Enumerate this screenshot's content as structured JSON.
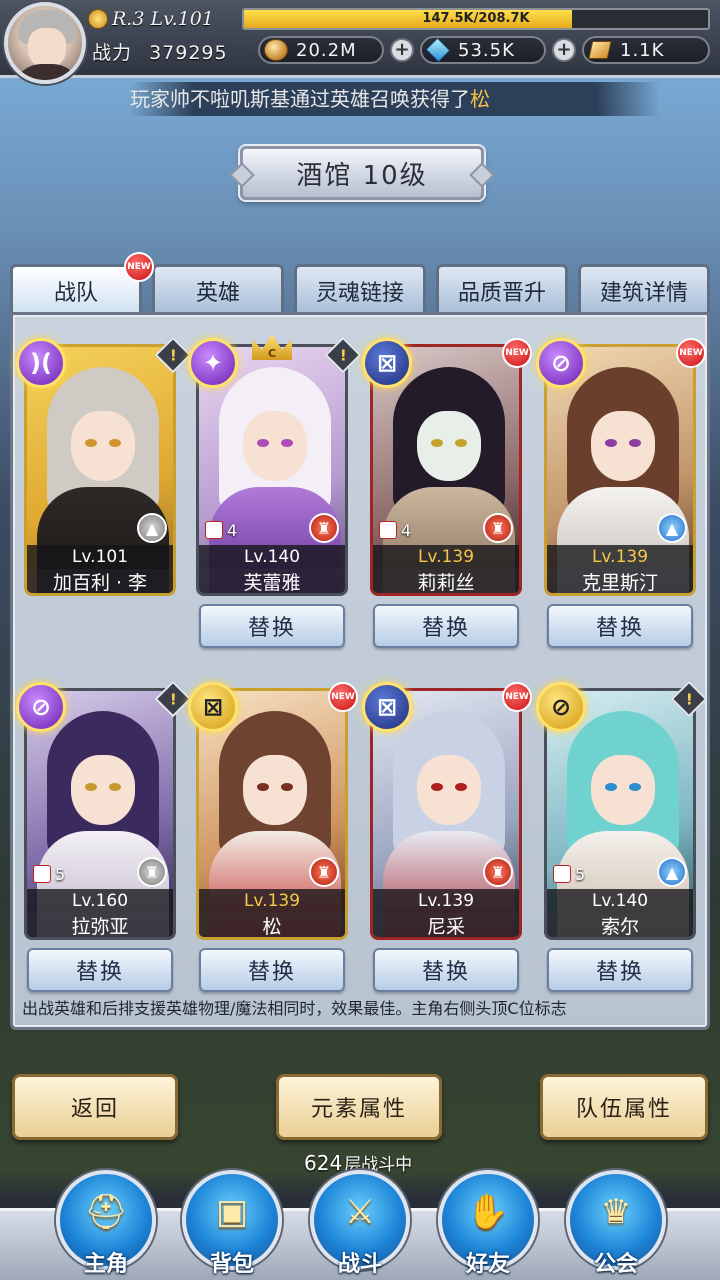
{
  "player": {
    "rank_level": "R.3 Lv.101",
    "exp_text": "147.5K/208.7K",
    "exp_progress": 0.707,
    "power_label": "战力",
    "power_value": "379295"
  },
  "currencies": [
    {
      "name": "gold",
      "value": "20.2M",
      "icon": "coin-icon"
    },
    {
      "name": "diamond",
      "value": "53.5K",
      "icon": "gem-icon"
    },
    {
      "name": "card",
      "value": "1.1K",
      "icon": "card-icon"
    }
  ],
  "marquee": {
    "prefix": "玩家帅不啦叽斯基通过英雄召唤获得了",
    "highlight": "松"
  },
  "title": "酒馆 10级",
  "tabs": [
    {
      "label": "战队",
      "active": true,
      "new": true
    },
    {
      "label": "英雄"
    },
    {
      "label": "灵魂链接"
    },
    {
      "label": "品质晋升"
    },
    {
      "label": "建筑详情"
    }
  ],
  "new_badge_text": "NEW",
  "alert_text": "!",
  "crown_text": "C",
  "heroes": [
    {
      "name": "加百利 · 李",
      "level": "Lv.101",
      "element": "purple",
      "element_glyph": ")(",
      "type_icon": "grey",
      "frame": "gold",
      "skills": "",
      "alert": true
    },
    {
      "name": "芙蕾雅",
      "level": "Lv.140",
      "element": "purple",
      "element_glyph": "✦",
      "type_icon": "red",
      "frame": "grey",
      "skills": "4",
      "alert": true,
      "crown": true
    },
    {
      "name": "莉莉丝",
      "level": "Lv.139",
      "element": "navy",
      "element_glyph": "⊠",
      "type_icon": "red",
      "frame": "red",
      "skills": "4",
      "new": true
    },
    {
      "name": "克里斯汀",
      "level": "Lv.139",
      "element": "purple",
      "element_glyph": "⊘",
      "type_icon": "blue",
      "frame": "gold",
      "skills": "",
      "new": true
    },
    {
      "name": "拉弥亚",
      "level": "Lv.160",
      "element": "purple",
      "element_glyph": "⊘",
      "type_icon": "grey",
      "frame": "grey",
      "skills": "5",
      "alert": true
    },
    {
      "name": "松",
      "level": "Lv.139",
      "element": "yellow",
      "element_glyph": "⊠",
      "type_icon": "red",
      "frame": "gold",
      "skills": "",
      "new": true
    },
    {
      "name": "尼采",
      "level": "Lv.139",
      "element": "navy",
      "element_glyph": "⊠",
      "type_icon": "red",
      "frame": "red",
      "skills": "",
      "new": true
    },
    {
      "name": "索尔",
      "level": "Lv.140",
      "element": "yellow",
      "element_glyph": "⊘",
      "type_icon": "blue",
      "frame": "grey",
      "skills": "5",
      "alert": true
    }
  ],
  "swap_label": "替换",
  "tip": "出战英雄和后排支援英雄物理/魔法相同时，效果最佳。主角右侧头顶C位标志",
  "actions": {
    "back": "返回",
    "element_attr": "元素属性",
    "team_attr": "队伍属性"
  },
  "battle_status": {
    "floor": "624",
    "text": "层战斗中"
  },
  "nav": [
    {
      "label": "主角",
      "icon": "helmet-icon"
    },
    {
      "label": "背包",
      "icon": "backpack-icon"
    },
    {
      "label": "战斗",
      "icon": "crossed-swords-icon"
    },
    {
      "label": "好友",
      "icon": "handshake-icon"
    },
    {
      "label": "公会",
      "icon": "guild-crest-icon"
    }
  ],
  "colors": {
    "accent_gold": "#f5c84a",
    "new_red": "#c81414",
    "nav_blue": "#1e86d8"
  }
}
